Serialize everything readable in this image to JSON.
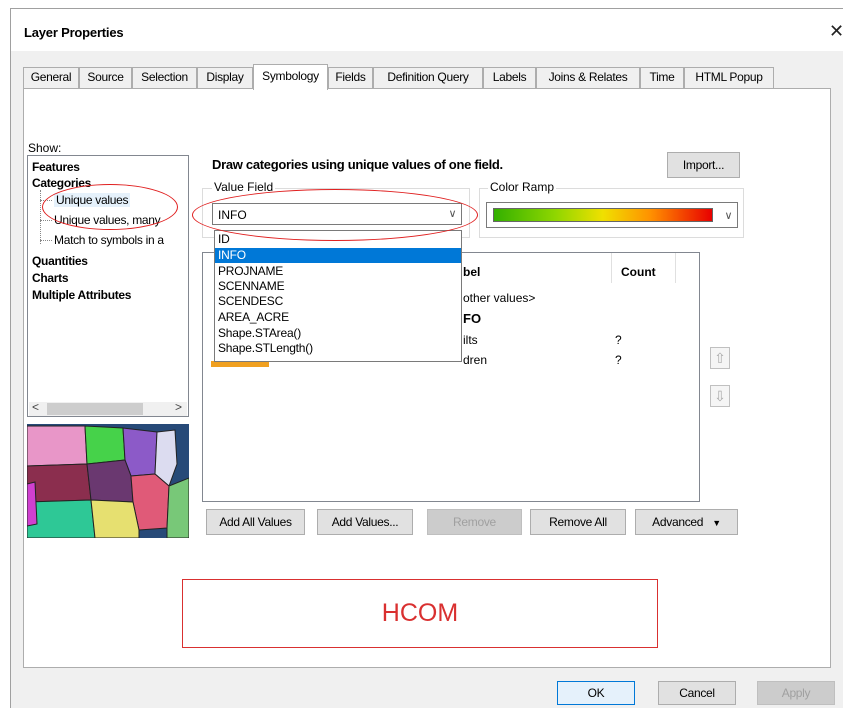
{
  "window": {
    "title": "Layer Properties",
    "close_glyph": "✕"
  },
  "tabs": [
    {
      "label": "General"
    },
    {
      "label": "Source"
    },
    {
      "label": "Selection"
    },
    {
      "label": "Display"
    },
    {
      "label": "Symbology",
      "active": true
    },
    {
      "label": "Fields"
    },
    {
      "label": "Definition Query"
    },
    {
      "label": "Labels"
    },
    {
      "label": "Joins & Relates"
    },
    {
      "label": "Time"
    },
    {
      "label": "HTML Popup"
    }
  ],
  "show": {
    "label": "Show:",
    "tree": [
      {
        "label": "Features",
        "bold": true
      },
      {
        "label": "Categories",
        "bold": true
      },
      {
        "label": "Unique values",
        "bold": false,
        "selected": true
      },
      {
        "label": "Unique values, many",
        "bold": false
      },
      {
        "label": "Match to symbols in a",
        "bold": false
      },
      {
        "label": "Quantities",
        "bold": true
      },
      {
        "label": "Charts",
        "bold": true
      },
      {
        "label": "Multiple Attributes",
        "bold": true
      }
    ]
  },
  "symbology": {
    "description": "Draw categories using unique values of one field.",
    "import_button": "Import...",
    "value_field": {
      "label": "Value Field",
      "value": "INFO",
      "options": [
        "ID",
        "INFO",
        "PROJNAME",
        "SCENNAME",
        "SCENDESC",
        "AREA_ACRE",
        "Shape.STArea()",
        "Shape.STLength()"
      ],
      "selected_index": 1
    },
    "color_ramp": {
      "label": "Color Ramp"
    },
    "table": {
      "columns": [
        "bel",
        "Count"
      ],
      "rows": [
        {
          "label": "other values>",
          "count": ""
        },
        {
          "label": "FO",
          "count": ""
        },
        {
          "label": "ilts",
          "count": "?"
        },
        {
          "label": "dren",
          "count": "?"
        }
      ]
    },
    "buttons": {
      "add_all": "Add All Values",
      "add_values": "Add Values...",
      "remove": "Remove",
      "remove_all": "Remove All",
      "advanced": "Advanced"
    }
  },
  "watermark": {
    "text": "HCOM"
  },
  "footer": {
    "ok": "OK",
    "cancel": "Cancel",
    "apply": "Apply"
  },
  "colors": {
    "accent": "#0078d7",
    "annotation": "#e02020",
    "hcom": "#d93030"
  }
}
